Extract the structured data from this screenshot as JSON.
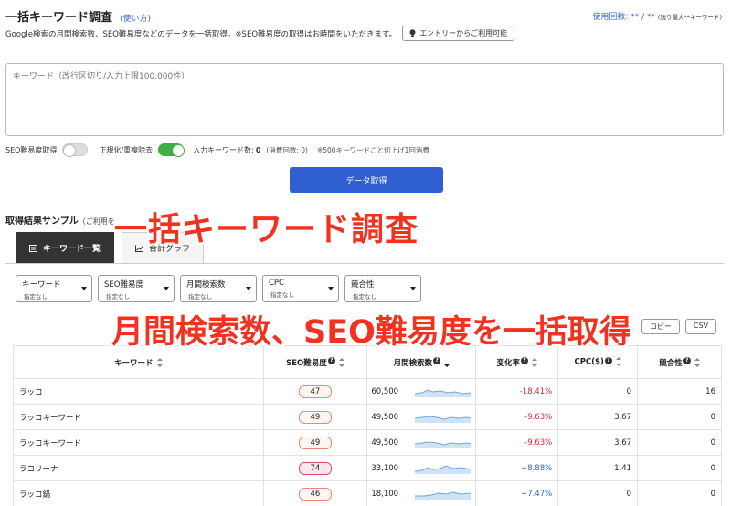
{
  "header": {
    "title": "一括キーワード調査",
    "howto": "(使い方)",
    "usage_label": "使用回数: ** / **",
    "usage_note": "(残り最大**キーワード)"
  },
  "description": {
    "text": "Google検索の月間検索数、SEO難易度などのデータを一括取得。※SEO難易度の取得はお時間をいただきます。",
    "entry_button": "エントリーからご利用可能"
  },
  "keyword_input": {
    "placeholder": "キーワード（改行区切り/入力上限100,000件）"
  },
  "options": {
    "seo_toggle_label": "SEO難易度取得",
    "normalize_toggle_label": "正規化/重複除去",
    "input_count_label": "入力キーワード数:",
    "input_count_value": "0",
    "consume_label": "(消費回数: 0)",
    "consume_note": "※500キーワードごと切上げ1回消費"
  },
  "get_button": "データ取得",
  "sample": {
    "title": "取得結果サンプル",
    "sub": "（ご利用を"
  },
  "tabs": [
    {
      "label": "キーワード一覧",
      "active": true
    },
    {
      "label": "合計グラフ",
      "active": false
    }
  ],
  "filters": [
    {
      "label": "キーワード",
      "sub": "指定なし"
    },
    {
      "label": "SEO難易度",
      "sub": "指定なし"
    },
    {
      "label": "月間検索数",
      "sub": "指定なし"
    },
    {
      "label": "CPC",
      "sub": "指定なし"
    },
    {
      "label": "競合性",
      "sub": "指定なし"
    }
  ],
  "tools": {
    "copy": "コピー",
    "csv": "CSV"
  },
  "table": {
    "headers": [
      "キーワード",
      "SEO難易度",
      "月間検索数",
      "変化率",
      "CPC($)",
      "競合性"
    ],
    "rows": [
      {
        "keyword": "ラッコ",
        "seo": "47",
        "volume": "60,500",
        "change": "-18.41%",
        "cpc": "0",
        "competition": "16"
      },
      {
        "keyword": "ラッコキーワード",
        "seo": "49",
        "volume": "49,500",
        "change": "-9.63%",
        "cpc": "3.67",
        "competition": "0"
      },
      {
        "keyword": "ラッコキーワード",
        "seo": "49",
        "volume": "49,500",
        "change": "-9.63%",
        "cpc": "3.67",
        "competition": "0"
      },
      {
        "keyword": "ラコリーナ",
        "seo": "74",
        "volume": "33,100",
        "change": "+8.88%",
        "cpc": "1.41",
        "competition": "0"
      },
      {
        "keyword": "ラッコ鍋",
        "seo": "46",
        "volume": "18,100",
        "change": "+7.47%",
        "cpc": "0",
        "competition": "0"
      }
    ]
  },
  "overlay": {
    "headline": "一括キーワード調査",
    "subline": "月間検索数、SEO難易度を一括取得"
  },
  "colors": {
    "accent": "#2f5fd0",
    "overlay": "#f2311f",
    "toggle_on": "#3cb043",
    "negative": "#e0263a"
  }
}
